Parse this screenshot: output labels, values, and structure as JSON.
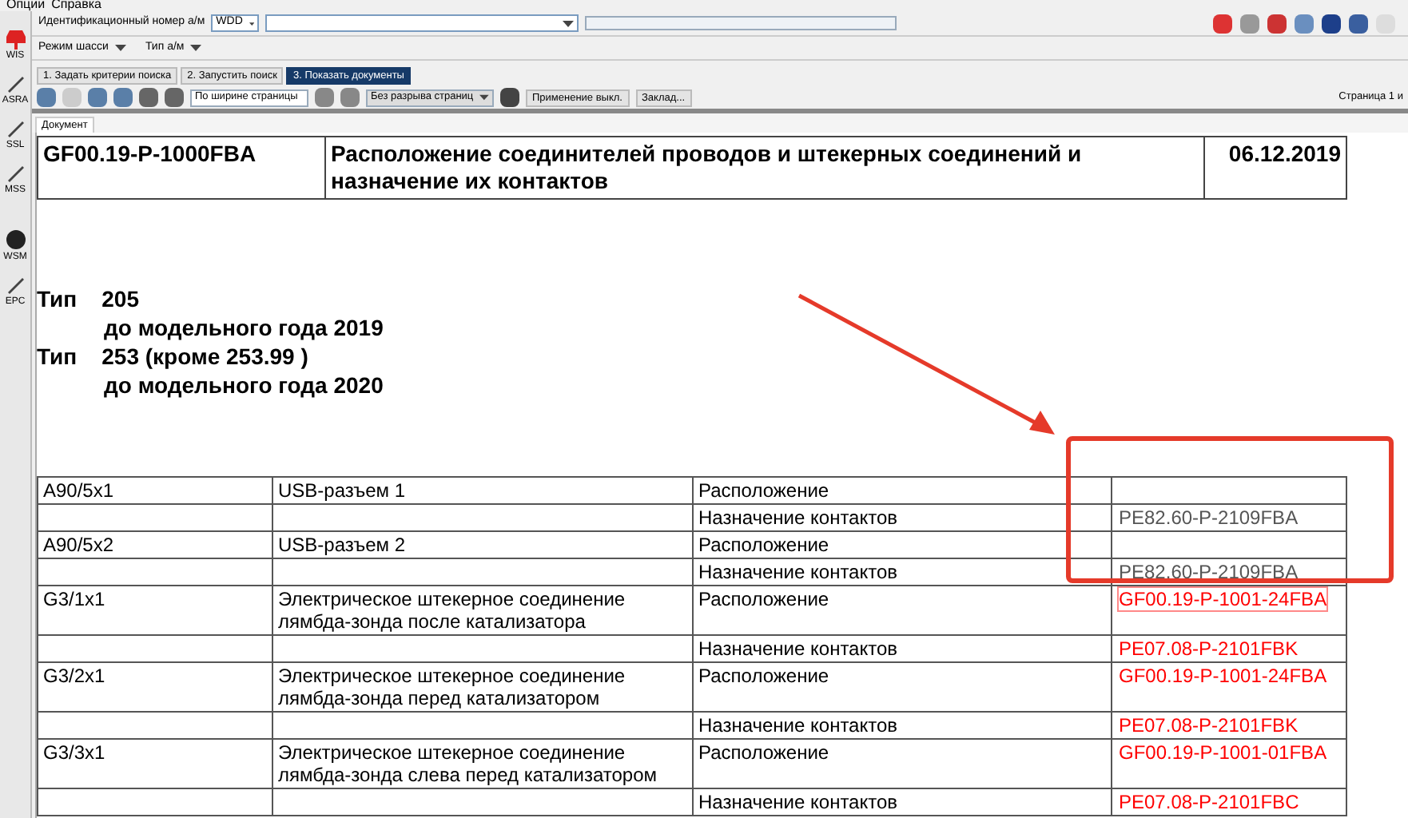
{
  "menu": [
    "Опции",
    "Справка"
  ],
  "sidebar": [
    {
      "label": "WIS"
    },
    {
      "label": "ASRA"
    },
    {
      "label": "SSL"
    },
    {
      "label": "MSS"
    },
    {
      "label": "WSM"
    },
    {
      "label": "EPC"
    }
  ],
  "vin": {
    "label": "Идентификационный номер а/м",
    "prefix": "WDD"
  },
  "mode_row": [
    "Режим шасси",
    "Тип а/м"
  ],
  "steps": [
    {
      "label": "1. Задать критерии поиска",
      "selected": false
    },
    {
      "label": "2. Запустить поиск",
      "selected": false
    },
    {
      "label": "3. Показать документы",
      "selected": true
    }
  ],
  "doc_toolbar": {
    "zoom": "По ширине страницы",
    "page_mode": "Без разрыва страниц",
    "buttons": [
      "Применение выкл.",
      "Заклад..."
    ],
    "page_info": "Страница 1 и"
  },
  "doc_tab": "Документ",
  "header": {
    "code": "GF00.19-P-1000FBA",
    "title": "Расположение соединителей проводов и штекерных соединений и назначение их контактов",
    "date": "06.12.2019"
  },
  "types": [
    {
      "type": "Тип    205",
      "note": "до модельного года 2019"
    },
    {
      "type": "Тип    253 (кроме 253.99 )",
      "note": "до модельного года 2020"
    }
  ],
  "rows": [
    {
      "id": "A90/5x1",
      "desc": "USB-разъем 1",
      "prop": "Расположение"
    },
    {
      "id": "",
      "desc": "",
      "prop": "Назначение контактов",
      "ref": "PE82.60-P-2109FBA",
      "color": "#555555",
      "focused": false
    },
    {
      "id": "A90/5x2",
      "desc": "USB-разъем 2",
      "prop": "Расположение"
    },
    {
      "id": "",
      "desc": "",
      "prop": "Назначение контактов",
      "ref": "PE82.60-P-2109FBA",
      "color": "#555555",
      "focused": false
    },
    {
      "id": "G3/1x1",
      "desc": "Электрическое штекерное соединение лямбда-зонда после катализатора",
      "prop": "Расположение",
      "ref": "GF00.19-P-1001-24FBA",
      "color": "#ff0000",
      "focused": true
    },
    {
      "id": "",
      "desc": "",
      "prop": "Назначение контактов",
      "ref": "PE07.08-P-2101FBK",
      "color": "#ff0000",
      "focused": false
    },
    {
      "id": "G3/2x1",
      "desc": "Электрическое штекерное соединение лямбда-зонда перед катализатором",
      "prop": "Расположение",
      "ref": "GF00.19-P-1001-24FBA",
      "color": "#ff0000",
      "focused": false
    },
    {
      "id": "",
      "desc": "",
      "prop": "Назначение контактов",
      "ref": "PE07.08-P-2101FBK",
      "color": "#ff0000",
      "focused": false
    },
    {
      "id": "G3/3x1",
      "desc": "Электрическое штекерное соединение лямбда-зонда слева перед катализатором",
      "prop": "Расположение",
      "ref": "GF00.19-P-1001-01FBA",
      "color": "#ff0000",
      "focused": false
    },
    {
      "id": "",
      "desc": "",
      "prop": "Назначение контактов",
      "ref": "PE07.08-P-2101FBC",
      "color": "#ff0000",
      "focused": false
    }
  ]
}
